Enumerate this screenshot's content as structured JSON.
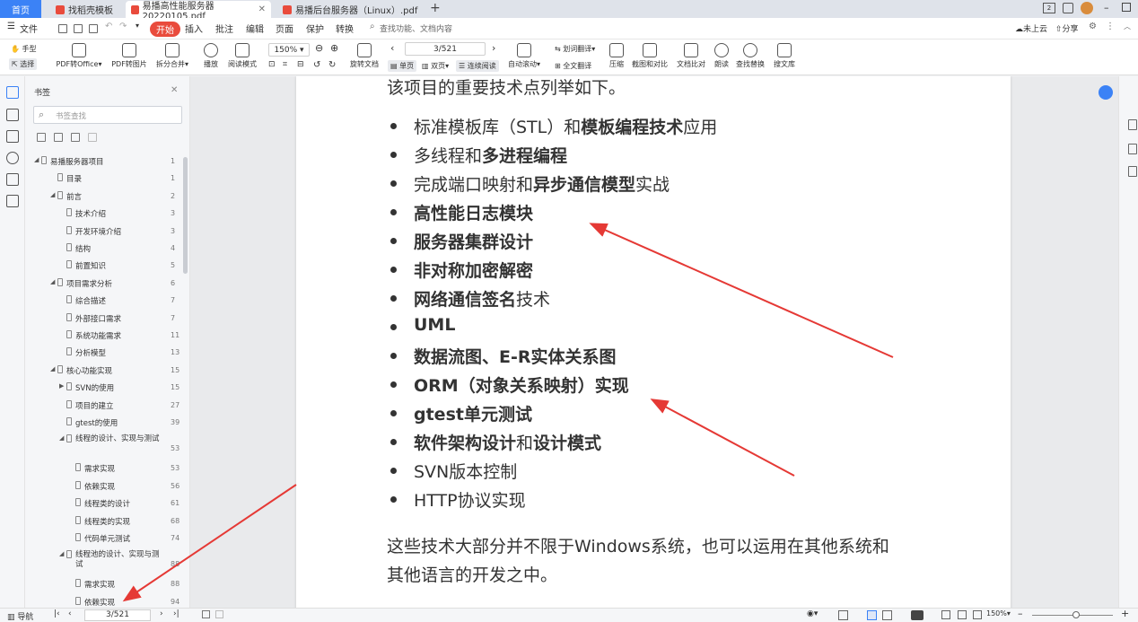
{
  "tabs": [
    {
      "label": "首页",
      "active": false
    },
    {
      "label": "找稻壳模板",
      "active": false
    },
    {
      "label": "易播高性能服务器20220105.pdf",
      "active": true
    },
    {
      "label": "易播后台服务器（Linux）.pdf",
      "active": false
    }
  ],
  "menu": {
    "file": "文件",
    "start": "开始",
    "items": [
      "插入",
      "批注",
      "编辑",
      "页面",
      "保护",
      "转换"
    ],
    "search_placeholder": "查找功能、文档内容",
    "cloud": "未上云",
    "share": "分享"
  },
  "toolbar": {
    "hand": "手型",
    "select": "选择",
    "pdf_office": "PDF转Office",
    "pdf_image": "PDF转图片",
    "split_merge": "拆分合并",
    "play": "播放",
    "read_mode": "阅读模式",
    "zoom": "150%",
    "page_value": "3/521",
    "rotate": "旋转文档",
    "single_page": "单页",
    "double_page": "双页",
    "continuous": "连续阅读",
    "auto_scroll": "自动滚动",
    "word_translate": "划词翻译",
    "full_translate": "全文翻译",
    "compress": "压缩",
    "screenshot_compare": "截图和对比",
    "doc_compare": "文档比对",
    "read_aloud": "朗读",
    "find_replace": "查找替换",
    "search_lib": "搜文库"
  },
  "sidebar": {
    "title": "书签",
    "search_placeholder": "书签查找",
    "items": [
      {
        "label": "易播服务器项目",
        "page": "1",
        "level": 0,
        "arrow": "◢"
      },
      {
        "label": "目录",
        "page": "1",
        "level": 1,
        "arrow": ""
      },
      {
        "label": "前言",
        "page": "2",
        "level": 1,
        "arrow": "◢"
      },
      {
        "label": "技术介绍",
        "page": "3",
        "level": 2,
        "arrow": ""
      },
      {
        "label": "开发环境介绍",
        "page": "3",
        "level": 2,
        "arrow": ""
      },
      {
        "label": "结构",
        "page": "4",
        "level": 2,
        "arrow": ""
      },
      {
        "label": "前置知识",
        "page": "5",
        "level": 2,
        "arrow": ""
      },
      {
        "label": "项目需求分析",
        "page": "6",
        "level": 1,
        "arrow": "◢"
      },
      {
        "label": "综合描述",
        "page": "7",
        "level": 2,
        "arrow": ""
      },
      {
        "label": "外部接口需求",
        "page": "7",
        "level": 2,
        "arrow": ""
      },
      {
        "label": "系统功能需求",
        "page": "11",
        "level": 2,
        "arrow": ""
      },
      {
        "label": "分析模型",
        "page": "13",
        "level": 2,
        "arrow": ""
      },
      {
        "label": "核心功能实现",
        "page": "15",
        "level": 1,
        "arrow": "◢"
      },
      {
        "label": "SVN的使用",
        "page": "15",
        "level": 2,
        "arrow": "▶"
      },
      {
        "label": "项目的建立",
        "page": "27",
        "level": 2,
        "arrow": ""
      },
      {
        "label": "gtest的使用",
        "page": "39",
        "level": 2,
        "arrow": ""
      },
      {
        "label": "线程的设计、实现与测试",
        "page": "53",
        "level": 2,
        "arrow": "◢"
      },
      {
        "label": "需求实现",
        "page": "53",
        "level": 3,
        "arrow": ""
      },
      {
        "label": "依赖实现",
        "page": "56",
        "level": 3,
        "arrow": ""
      },
      {
        "label": "线程类的设计",
        "page": "61",
        "level": 3,
        "arrow": ""
      },
      {
        "label": "线程类的实现",
        "page": "68",
        "level": 3,
        "arrow": ""
      },
      {
        "label": "代码单元测试",
        "page": "74",
        "level": 3,
        "arrow": ""
      },
      {
        "label": "线程池的设计、实现与测试",
        "page": "88",
        "level": 2,
        "arrow": "◢"
      },
      {
        "label": "需求实现",
        "page": "88",
        "level": 3,
        "arrow": ""
      },
      {
        "label": "依赖实现",
        "page": "94",
        "level": 3,
        "arrow": ""
      }
    ]
  },
  "document": {
    "intro": "该项目的重要技术点列举如下。",
    "bullets": [
      [
        {
          "t": "标准模板库（STL）和",
          "b": false
        },
        {
          "t": "模板编程技术",
          "b": true
        },
        {
          "t": "应用",
          "b": false
        }
      ],
      [
        {
          "t": "多线程和",
          "b": false
        },
        {
          "t": "多进程编程",
          "b": true
        }
      ],
      [
        {
          "t": "完成端口映射和",
          "b": false
        },
        {
          "t": "异步通信模型",
          "b": true
        },
        {
          "t": "实战",
          "b": false
        }
      ],
      [
        {
          "t": "高性能日志模块",
          "b": true
        }
      ],
      [
        {
          "t": "服务器集群设计",
          "b": true
        }
      ],
      [
        {
          "t": "非对称加密解密",
          "b": true
        }
      ],
      [
        {
          "t": "网络通信签名",
          "b": true
        },
        {
          "t": "技术",
          "b": false
        }
      ],
      [
        {
          "t": "UML",
          "b": true
        }
      ],
      [
        {
          "t": "数据流图、E-R实体关系图",
          "b": true
        }
      ],
      [
        {
          "t": "ORM（对象关系映射）实现",
          "b": true
        }
      ],
      [
        {
          "t": "gtest单元测试",
          "b": true
        }
      ],
      [
        {
          "t": "软件架构设计",
          "b": true
        },
        {
          "t": "和",
          "b": false
        },
        {
          "t": "设计模式",
          "b": true
        }
      ],
      [
        {
          "t": "SVN版本控制",
          "b": false
        }
      ],
      [
        {
          "t": "HTTP协议实现",
          "b": false
        }
      ]
    ],
    "para1": "这些技术大部分并不限于Windows系统，也可以运用在其他系统和",
    "para2": "其他语言的开发之中。"
  },
  "status": {
    "nav": "导航",
    "page_value": "3/521",
    "zoom": "150%"
  },
  "colors": {
    "accent": "#3b82f6",
    "start_button": "#e94b3c",
    "arrow_red": "#e53935"
  }
}
